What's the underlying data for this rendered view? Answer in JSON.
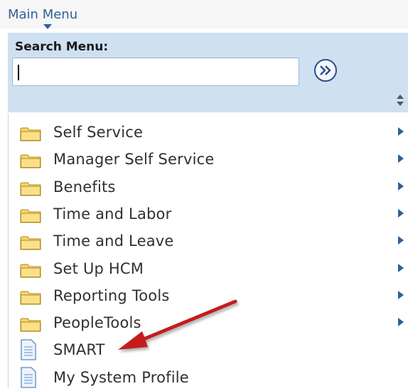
{
  "header": {
    "title": "Main Menu"
  },
  "search": {
    "label": "Search Menu:",
    "value": "",
    "placeholder": ""
  },
  "menu": {
    "items": [
      {
        "label": "Self Service",
        "type": "folder",
        "has_submenu": true
      },
      {
        "label": "Manager Self Service",
        "type": "folder",
        "has_submenu": true
      },
      {
        "label": "Benefits",
        "type": "folder",
        "has_submenu": true
      },
      {
        "label": "Time and Labor",
        "type": "folder",
        "has_submenu": true
      },
      {
        "label": "Time and Leave",
        "type": "folder",
        "has_submenu": true
      },
      {
        "label": "Set Up HCM",
        "type": "folder",
        "has_submenu": true
      },
      {
        "label": "Reporting Tools",
        "type": "folder",
        "has_submenu": true
      },
      {
        "label": "PeopleTools",
        "type": "folder",
        "has_submenu": true
      },
      {
        "label": "SMART",
        "type": "page",
        "has_submenu": false
      },
      {
        "label": "My System Profile",
        "type": "page",
        "has_submenu": false
      }
    ]
  },
  "icons": {
    "folder": "folder-icon",
    "page": "document-icon",
    "go": "double-chevron-right-icon",
    "sort": "sort-icon",
    "submenu": "triangle-right-icon"
  },
  "colors": {
    "link": "#2f5f9a",
    "search_panel_bg": "#cfe0f1",
    "folder_fill": "#f7d56a",
    "annotation_arrow": "#c41e1e"
  }
}
